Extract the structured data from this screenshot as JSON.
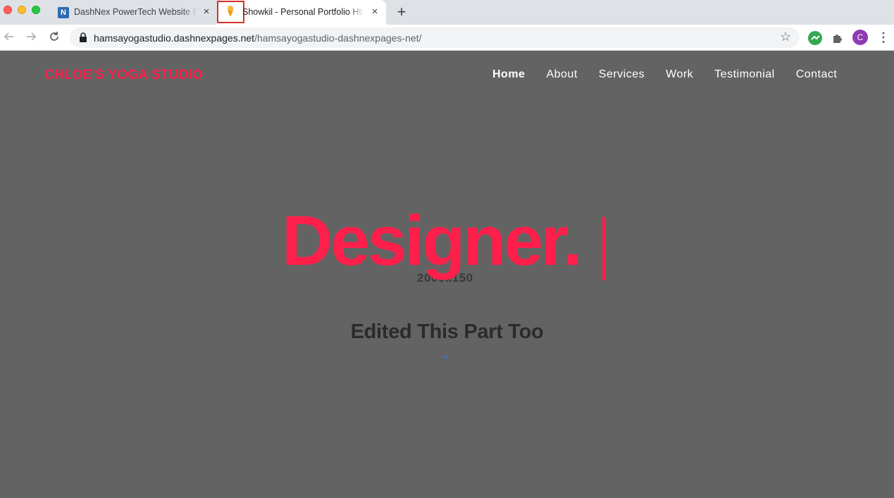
{
  "browser": {
    "tabs": [
      {
        "title": "DashNex PowerTech Website Builder",
        "favicon": "dashnex-icon",
        "active": false
      },
      {
        "title": "Showkil - Personal Portfolio Html Template",
        "favicon": "ice-cream-icon",
        "active": true
      }
    ],
    "url": {
      "host": "hamsayogastudio.dashnexpages.net",
      "path": "/hamsayogastudio-dashnexpages-net/"
    },
    "avatar_initial": "C",
    "new_tab_glyph": "+",
    "close_glyph": "×"
  },
  "site": {
    "brand": "CHLOE'S YOGA STUDIO",
    "nav": [
      {
        "label": "Home",
        "active": true
      },
      {
        "label": "About",
        "active": false
      },
      {
        "label": "Services",
        "active": false
      },
      {
        "label": "Work",
        "active": false
      },
      {
        "label": "Testimonial",
        "active": false
      },
      {
        "label": "Contact",
        "active": false
      }
    ],
    "hero_word": "Designer.",
    "hero_ghost_text": "2000x150",
    "subheading": "Edited This Part Too"
  },
  "colors": {
    "accent": "#ff1f4b",
    "page_background": "#636363",
    "subheading": "#2b2b2b"
  }
}
